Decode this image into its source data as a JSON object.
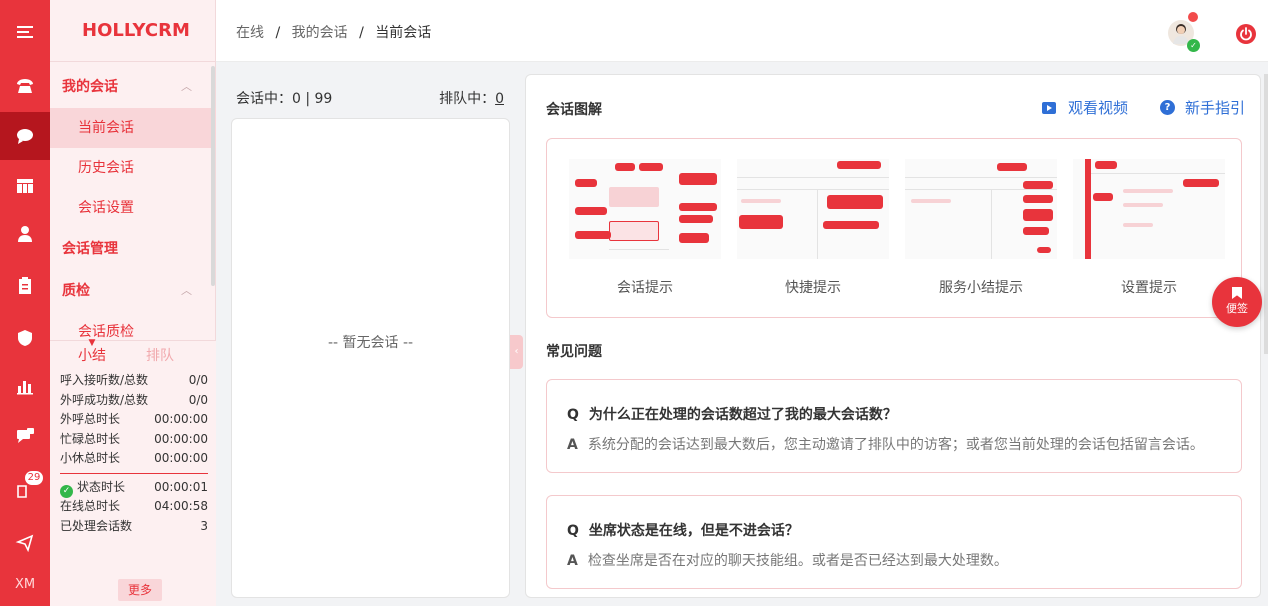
{
  "brand": "HOLLYCRM",
  "rail": {
    "badge_count": "29",
    "user_initials": "XM"
  },
  "breadcrumb": {
    "level1": "在线",
    "level2": "我的会话",
    "current": "当前会话",
    "separator": "/"
  },
  "nav": {
    "sections": [
      {
        "label": "我的会话",
        "expanded": true,
        "items": [
          "当前会话",
          "历史会话",
          "会话设置"
        ]
      },
      {
        "label": "会话管理"
      },
      {
        "label": "质检",
        "expanded": true,
        "items": [
          "会话质检"
        ]
      }
    ],
    "active_item": "当前会话"
  },
  "stats": {
    "tabs": [
      "小结",
      "排队"
    ],
    "rows": [
      {
        "label": "呼入接听数/总数",
        "value": "0/0"
      },
      {
        "label": "外呼成功数/总数",
        "value": "0/0"
      },
      {
        "label": "外呼总时长",
        "value": "00:00:00"
      },
      {
        "label": "忙碌总时长",
        "value": "00:00:00"
      },
      {
        "label": "小休总时长",
        "value": "00:00:00"
      }
    ],
    "rows2": [
      {
        "label": "状态时长",
        "value": "00:00:01"
      },
      {
        "label": "在线总时长",
        "value": "04:00:58"
      },
      {
        "label": "已处理会话数",
        "value": "3"
      }
    ],
    "more_label": "更多"
  },
  "conversations": {
    "active_label": "会话中：",
    "active_value": "0 | 99",
    "queue_label": "排队中：",
    "queue_value": "0",
    "empty_text": "-- 暂无会话 --"
  },
  "guide": {
    "title": "会话图解",
    "video_label": "观看视频",
    "help_label": "新手指引",
    "thumbnails": [
      "会话提示",
      "快捷提示",
      "服务小结提示",
      "设置提示"
    ],
    "faq_title": "常见问题",
    "faqs": [
      {
        "q": "为什么正在处理的会话数超过了我的最大会话数？",
        "a": "系统分配的会话达到最大数后，您主动邀请了排队中的访客；或者您当前处理的会话包括留言会话。"
      },
      {
        "q": "坐席状态是在线，但是不进会话？",
        "a": "检查坐席是否在对应的聊天技能组。或者是否已经达到最大处理数。"
      }
    ],
    "q_mark": "Q",
    "a_mark": "A"
  },
  "note_label": "便签",
  "colors": {
    "accent": "#e8343c",
    "link": "#2f6fd6",
    "success": "#33b74a"
  }
}
